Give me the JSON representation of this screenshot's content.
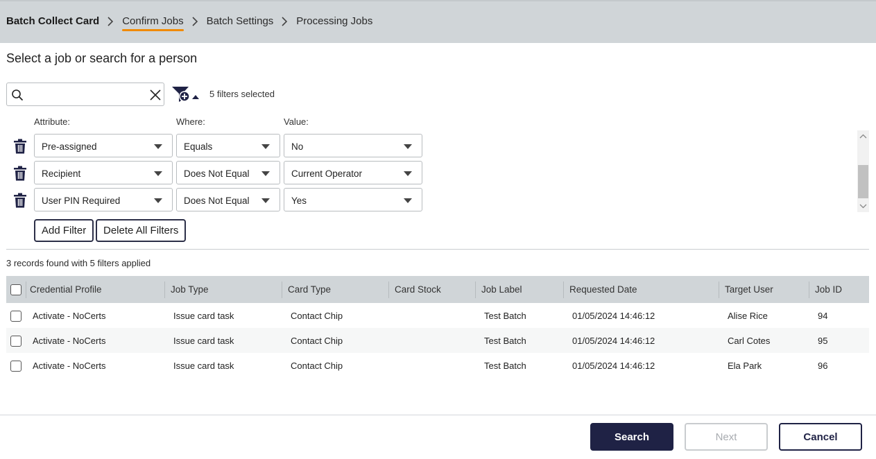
{
  "breadcrumb": {
    "items": [
      "Batch Collect Card",
      "Confirm Jobs",
      "Batch Settings",
      "Processing Jobs"
    ],
    "active_index": 1
  },
  "page_title": "Select a job or search for a person",
  "search": {
    "value": "",
    "placeholder": ""
  },
  "filter_summary": "5 filters selected",
  "filter_headers": {
    "attribute": "Attribute:",
    "where": "Where:",
    "value": "Value:"
  },
  "filters": [
    {
      "attribute": "Pre-assigned",
      "where": "Equals",
      "value": "No"
    },
    {
      "attribute": "Recipient",
      "where": "Does Not Equal",
      "value": "Current Operator"
    },
    {
      "attribute": "User PIN Required",
      "where": "Does Not Equal",
      "value": "Yes"
    }
  ],
  "buttons": {
    "add_filter": "Add Filter",
    "delete_all_filters": "Delete All Filters"
  },
  "records_summary": "3 records found with 5 filters applied",
  "table": {
    "columns": [
      "Credential Profile",
      "Job Type",
      "Card Type",
      "Card Stock",
      "Job Label",
      "Requested Date",
      "Target User",
      "Job ID"
    ],
    "rows": [
      [
        "Activate - NoCerts",
        "Issue card task",
        "Contact Chip",
        "",
        "Test Batch",
        "01/05/2024 14:46:12",
        "Alise Rice",
        "94"
      ],
      [
        "Activate - NoCerts",
        "Issue card task",
        "Contact Chip",
        "",
        "Test Batch",
        "01/05/2024 14:46:12",
        "Carl Cotes",
        "95"
      ],
      [
        "Activate - NoCerts",
        "Issue card task",
        "Contact Chip",
        "",
        "Test Batch",
        "01/05/2024 14:46:12",
        "Ela Park",
        "96"
      ]
    ]
  },
  "footer": {
    "search": "Search",
    "next": "Next",
    "cancel": "Cancel"
  },
  "colors": {
    "accent": "#f08a00",
    "primary": "#1f2245",
    "header_bg": "#d0d5d8"
  },
  "icons": {
    "search": "search-icon",
    "clear": "close-icon",
    "filter": "filter-add-icon",
    "delete": "trash-icon"
  }
}
